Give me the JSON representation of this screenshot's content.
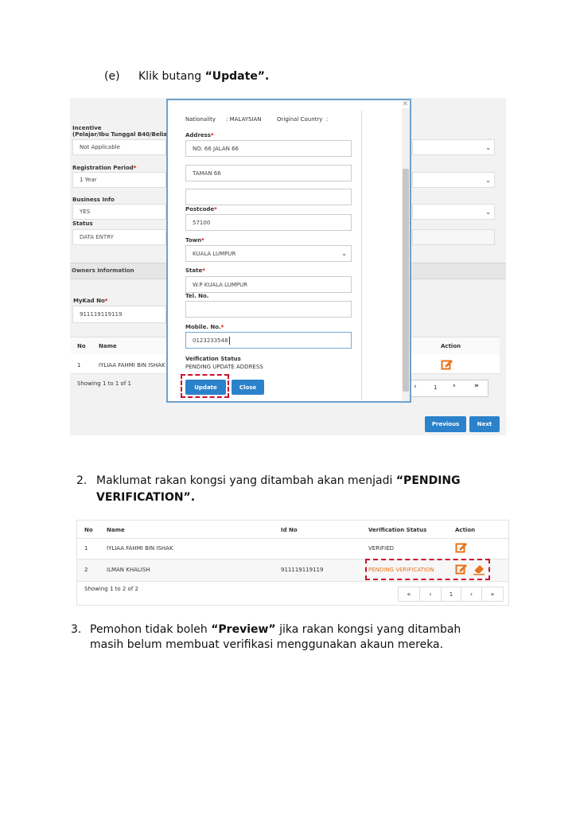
{
  "step_e": {
    "marker": "(e)",
    "text": "Klik butang ",
    "bold": "“Update”."
  },
  "shot1": {
    "incentive_label": "Incentive",
    "incentive_sub": "(Pelajar/Ibu Tunggal B40/Belia I",
    "incentive_value": "Not Applicable",
    "reg_period_label": "Registration Period",
    "reg_period_value": "1 Year",
    "business_info_label": "Business Info",
    "business_info_value": "YES",
    "status_label": "Status",
    "status_value": "DATA ENTRY",
    "owners_header": "Owners Information",
    "mykad_label": "MyKad No",
    "mykad_value": "911119119119",
    "col_no": "No",
    "col_name": "Name",
    "col_action": "Action",
    "row_no": "1",
    "row_name": "IYLIAA FAHMI BIN ISHAK",
    "showing": "Showing 1 to 1 of 1",
    "pager": [
      "‹",
      "1",
      "›",
      "»"
    ],
    "previous_btn": "Previous",
    "next_btn": "Next",
    "required_mark": "*"
  },
  "modal": {
    "close_x": "✕",
    "nationality_label": "Nationality",
    "nationality_value": ": MALAYSIAN",
    "original_country": "Original Country  :",
    "address_label": "Address",
    "address1": "NO. 66 JALAN 66",
    "address2": "TAMAN 66",
    "address3": "",
    "postcode_label": "Postcode",
    "postcode": "57100",
    "town_label": "Town",
    "town": "KUALA LUMPUR",
    "state_label": "State",
    "state": "W.P KUALA LUMPUR",
    "tel_label": "Tel. No.",
    "tel": "",
    "mobile_label": "Mobile. No.",
    "mobile": "0123233548",
    "verif_label": "Veification Status",
    "verif_value": "PENDING UPDATE ADDRESS",
    "update_btn": "Update",
    "close_btn": "Close"
  },
  "step2": {
    "number": "2.",
    "text": "Maklumat rakan kongsi yang ditambah akan menjadi ",
    "bold1": "“PENDING",
    "bold2": "VERIFICATION”."
  },
  "shot2": {
    "headers": {
      "no": "No",
      "name": "Name",
      "id": "Id No",
      "status": "Verification Status",
      "action": "Action"
    },
    "rows": [
      {
        "no": "1",
        "name": "IYLIAA FAHMI BIN ISHAK",
        "id": "",
        "status": "VERIFIED"
      },
      {
        "no": "2",
        "name": "ILMAN KHALISH",
        "id": "911119119119",
        "status": "PENDING VERIFICATION"
      }
    ],
    "showing": "Showing 1 to 2 of 2",
    "pager": [
      "«",
      "‹",
      "1",
      "›",
      "»"
    ]
  },
  "step3": {
    "number": "3.",
    "text1": "Pemohon tidak boleh ",
    "bold": "“Preview”",
    "text2": " jika rakan kongsi yang ditambah",
    "line2": "masih belum membuat verifikasi menggunakan akaun mereka."
  },
  "colors": {
    "blue": "#2b82cb",
    "red": "#c8102e",
    "orange": "#e8731a"
  }
}
